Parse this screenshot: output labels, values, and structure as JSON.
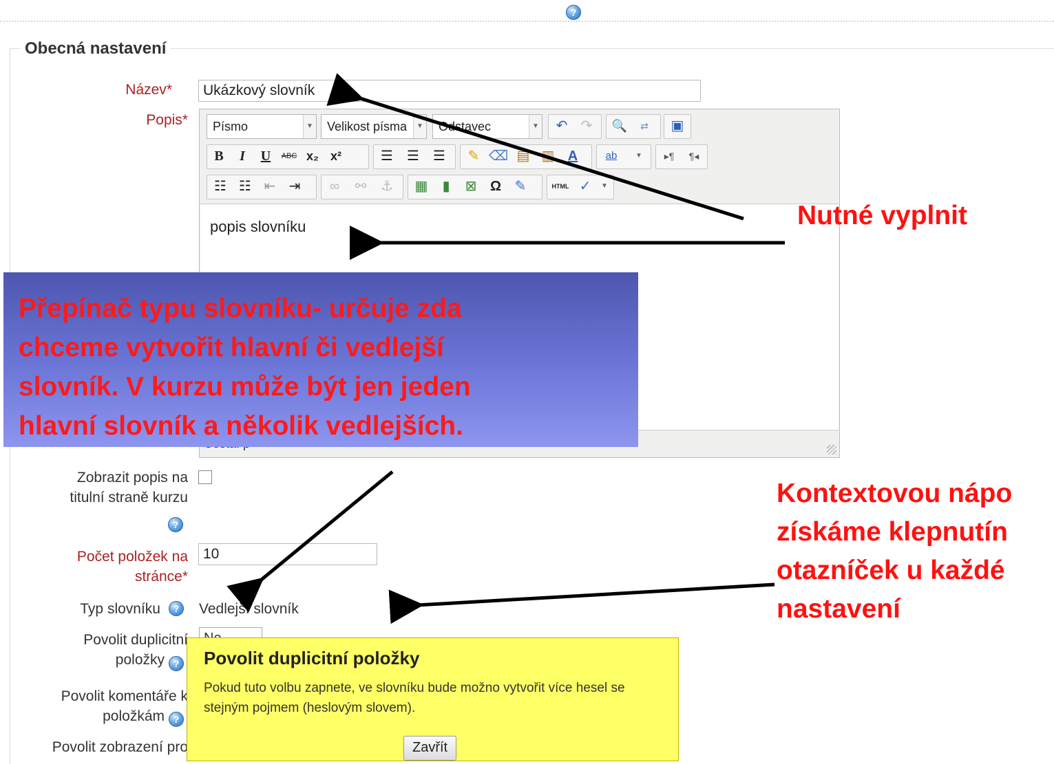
{
  "section": {
    "title": "Obecná nastavení"
  },
  "form": {
    "name": {
      "label": "Název",
      "required_mark": "*",
      "value": "Ukázkový slovník"
    },
    "description": {
      "label": "Popis",
      "required_mark": "*",
      "editor": {
        "font_select": "Písmo",
        "size_select": "Velikost písma",
        "format_select": "Odstavec",
        "row1_icons": [
          "undo-icon",
          "redo-icon",
          "find-icon",
          "replace-icon",
          "fullscreen-icon"
        ],
        "row2_icons": [
          "bold-icon",
          "italic-icon",
          "underline-icon",
          "strikethrough-icon",
          "subscript-icon",
          "superscript-icon",
          "align-left-icon",
          "align-center-icon",
          "align-right-icon",
          "cleanup-icon",
          "eraser-icon",
          "paste-text-icon",
          "paste-word-icon",
          "font-color-icon",
          "highlight-color-icon",
          "ltr-icon",
          "rtl-icon"
        ],
        "row3_icons": [
          "bullet-list-icon",
          "numbered-list-icon",
          "outdent-icon",
          "indent-icon",
          "link-icon",
          "unlink-icon",
          "anchor-icon",
          "image-icon",
          "media-icon",
          "nonbreaking-icon",
          "special-char-icon",
          "edit-icon",
          "html-icon",
          "spellcheck-icon"
        ],
        "labels": {
          "bold": "B",
          "italic": "I",
          "underline": "U",
          "strike": "ABC",
          "sub": "x₂",
          "sup": "x²",
          "omega": "Ω",
          "html": "HTML"
        },
        "content": "popis slovníku",
        "path": "Cesta: p"
      }
    },
    "show_description": {
      "label_line1": "Zobrazit popis na",
      "label_line2": "titulní straně kurzu",
      "checked": false
    },
    "entries_per_page": {
      "label_line1": "Počet položek na",
      "label_line2": "stránce",
      "required_mark": "*",
      "value": "10"
    },
    "glossary_type": {
      "label": "Typ slovníku",
      "value": "Vedlejší slovník"
    },
    "allow_duplicates": {
      "label_line1": "Povolit duplicitní",
      "label_line2": "položky",
      "value": "Ne"
    },
    "allow_comments": {
      "label_line1": "Povolit komentáře k",
      "label_line2": "položkám"
    },
    "allow_print": {
      "label_line1": "Povolit zobrazení pro"
    }
  },
  "annotations": {
    "required": "Nutné vyplnit",
    "type_switch": [
      "Přepínač typu slovníku- určuje zda",
      "chceme vytvořit hlavní či vedlejší",
      "slovník. V kurzu může být jen jeden",
      "hlavní slovník a několik vedlejších."
    ],
    "context_help": [
      "Kontextovou nápo",
      "získáme klepnutín",
      "otazníček u každé",
      "nastavení"
    ]
  },
  "help_popup": {
    "title": "Povolit duplicitní položky",
    "body": "Pokud tuto volbu zapnete, ve slovníku bude možno vytvořit více hesel se stejným pojmem (heslovým slovem).",
    "close_label": "Zavřít"
  },
  "help_glyph": "?",
  "colors": {
    "required": "#aa2222",
    "annotation": "#ff1111",
    "popup_bg": "#ffff66",
    "callout_bg": "#6a74d4"
  }
}
